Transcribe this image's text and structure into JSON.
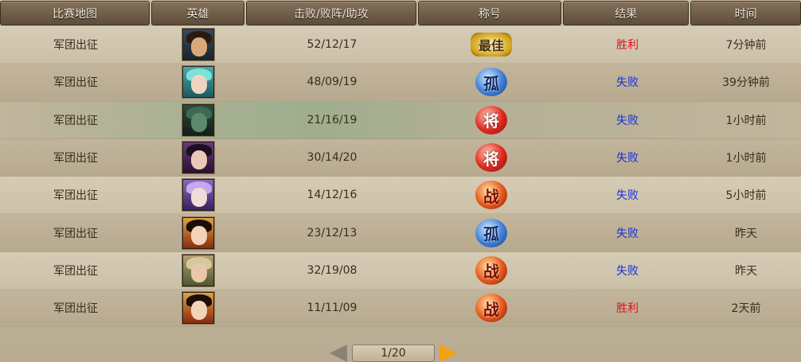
{
  "columns": [
    "比赛地图",
    "英雄",
    "击败/败阵/助攻",
    "称号",
    "结果",
    "时间"
  ],
  "rows": [
    {
      "map": "军团出征",
      "hero_icon": "hero-portrait-bearded-man",
      "kda": "52/12/17",
      "title_icon": "best-badge",
      "title_text": "最佳",
      "result": "胜利",
      "result_type": "win",
      "time": "7分钟前"
    },
    {
      "map": "军团出征",
      "hero_icon": "hero-portrait-teal-haired-woman",
      "kda": "48/09/19",
      "title_icon": "solo-badge",
      "title_text": "孤",
      "result": "失败",
      "result_type": "lose",
      "time": "39分钟前"
    },
    {
      "map": "军团出征",
      "hero_icon": "hero-portrait-masked-warrior",
      "kda": "21/16/19",
      "title_icon": "general-badge",
      "title_text": "将",
      "result": "失败",
      "result_type": "lose",
      "time": "1小时前"
    },
    {
      "map": "军团出征",
      "hero_icon": "hero-portrait-dark-haired-man",
      "kda": "30/14/20",
      "title_icon": "general-badge",
      "title_text": "将",
      "result": "失败",
      "result_type": "lose",
      "time": "1小时前"
    },
    {
      "map": "军团出征",
      "hero_icon": "hero-portrait-purple-haired-woman",
      "kda": "14/12/16",
      "title_icon": "battle-badge",
      "title_text": "战",
      "result": "失败",
      "result_type": "lose",
      "time": "5小时前"
    },
    {
      "map": "军团出征",
      "hero_icon": "hero-portrait-red-clad-woman",
      "kda": "23/12/13",
      "title_icon": "solo-badge",
      "title_text": "孤",
      "result": "失败",
      "result_type": "lose",
      "time": "昨天"
    },
    {
      "map": "军团出征",
      "hero_icon": "hero-portrait-armored-man",
      "kda": "32/19/08",
      "title_icon": "battle-badge",
      "title_text": "战",
      "result": "失败",
      "result_type": "lose",
      "time": "昨天"
    },
    {
      "map": "军团出征",
      "hero_icon": "hero-portrait-red-clad-woman",
      "kda": "11/11/09",
      "title_icon": "battle-badge",
      "title_text": "战",
      "result": "胜利",
      "result_type": "win",
      "time": "2天前"
    }
  ],
  "pager": {
    "text": "1/20"
  },
  "colors": {
    "win": "#e0101a",
    "lose": "#1530d8",
    "next_arrow": "#f2a20c"
  }
}
